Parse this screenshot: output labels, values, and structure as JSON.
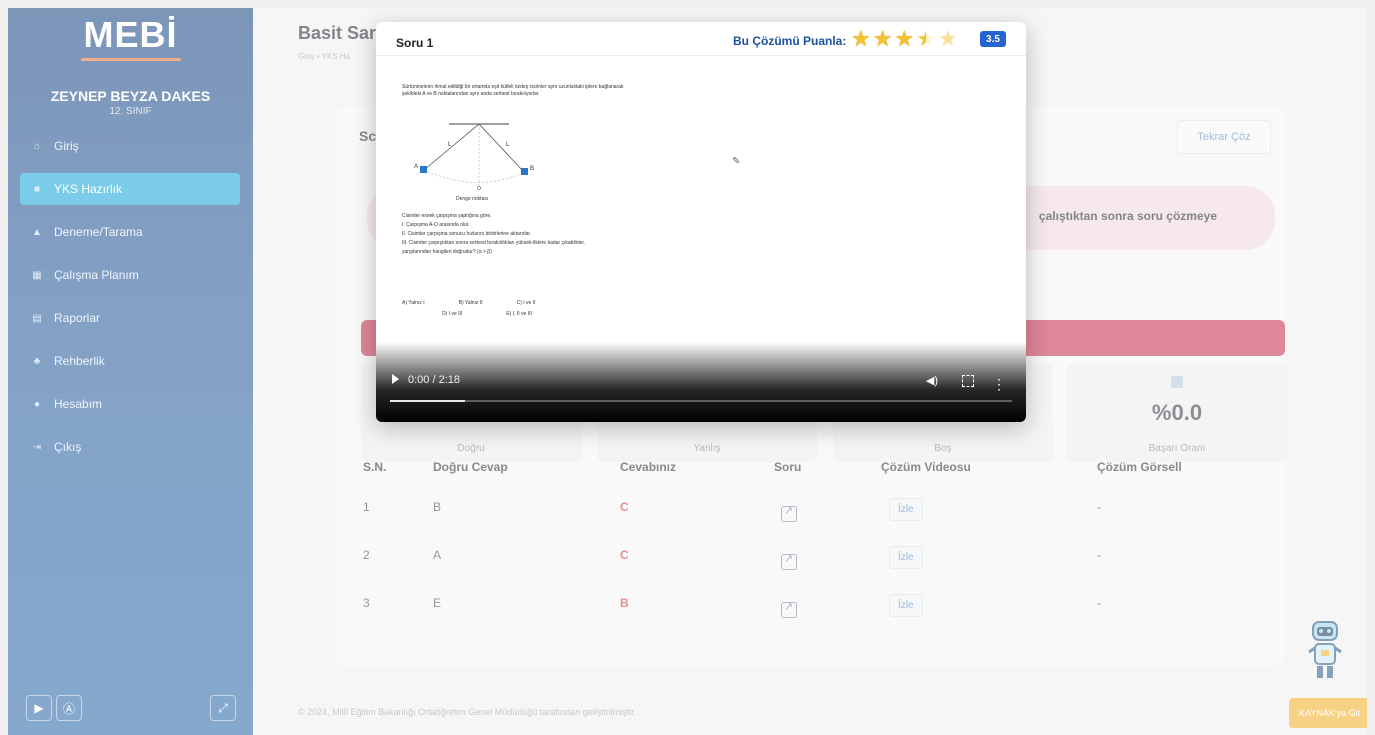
{
  "sidebar": {
    "logo": "MEBİ",
    "user_name": "ZEYNEP BEYZA DAKES",
    "grade": "12. SINIF",
    "items": [
      {
        "label": "Giriş",
        "icon": "home-icon",
        "active": false
      },
      {
        "label": "YKS Hazırlık",
        "icon": "book-icon",
        "active": true
      },
      {
        "label": "Deneme/Tarama",
        "icon": "graduation-cap-icon",
        "active": false
      },
      {
        "label": "Çalışma Planım",
        "icon": "calendar-icon",
        "active": false
      },
      {
        "label": "Raporlar",
        "icon": "report-icon",
        "active": false
      },
      {
        "label": "Rehberlik",
        "icon": "users-icon",
        "active": false
      },
      {
        "label": "Hesabım",
        "icon": "user-icon",
        "active": false
      },
      {
        "label": "Çıkış",
        "icon": "logout-icon",
        "active": false
      }
    ]
  },
  "header": {
    "title": "Basit Sar",
    "breadcrumb": "Giriş • YKS Ha"
  },
  "card": {
    "heading": "Sc",
    "retry_label": "Tekrar Çöz",
    "alert_text": "çalıştıktan sonra soru çözmeye"
  },
  "stats": [
    {
      "label": "Doğru",
      "value": ""
    },
    {
      "label": "Yanlış",
      "value": ""
    },
    {
      "label": "Boş",
      "value": ""
    },
    {
      "label": "Başarı Oranı",
      "value": "%0.0"
    }
  ],
  "table": {
    "headers": [
      "S.N.",
      "Doğru Cevap",
      "Cevabınız",
      "Soru",
      "Çözüm Videosu",
      "Çözüm Görsell"
    ],
    "rows": [
      {
        "sn": "1",
        "correct": "B",
        "answer": "C",
        "watch": "İzle",
        "image": "-"
      },
      {
        "sn": "2",
        "correct": "A",
        "answer": "C",
        "watch": "İzle",
        "image": "-"
      },
      {
        "sn": "3",
        "correct": "E",
        "answer": "B",
        "watch": "İzle",
        "image": "-"
      }
    ]
  },
  "footer": "© 2024, Millî Eğitim Bakanlığı Ortaöğretim Genel Müdürlüğü tarafından geliştirilmiştir.",
  "kaynak_label": "KAYNAK'ya Git",
  "modal": {
    "title": "Soru 1",
    "rate_label": "Bu Çözümü Puanla:",
    "rating": "3.5",
    "stars": [
      "full",
      "full",
      "full",
      "half",
      "empty"
    ],
    "question": {
      "intro": "Sürtünmelerin ihmal edildiği bir ortamda eşit kütleli özdeş cisimler aynı uzunluktaki iplere bağlanarak şekildeki A ve B noktalarından aynı anda serbest bırakılıyorlar.",
      "figure_label": "Denge noktası",
      "figure_o": "O",
      "figure_a": "A",
      "figure_b": "B",
      "figure_l": "L",
      "prompt": "Cisimler esnek çarpışma yaptığına göre,",
      "statements": [
        "I. Çarpışma A-O arasında olur.",
        "II. Cisimler çarpışma sonucu hızlarını birbirlerine aktarırlar.",
        "III. Cisimler çarpıştıktan sonra serbest bırakıldıkları yüksek-liklere kadar çıkabilirler."
      ],
      "question_line": "yargılarından hangileri doğrudur? (α > β)",
      "choices_row1": [
        "A) Yalnız I",
        "B) Yalnız II",
        "C) I ve II"
      ],
      "choices_row2": [
        "D) I ve III",
        "E) I, II ve III"
      ]
    },
    "video": {
      "time": "0:00 / 2:18",
      "progress": 0.12
    }
  }
}
